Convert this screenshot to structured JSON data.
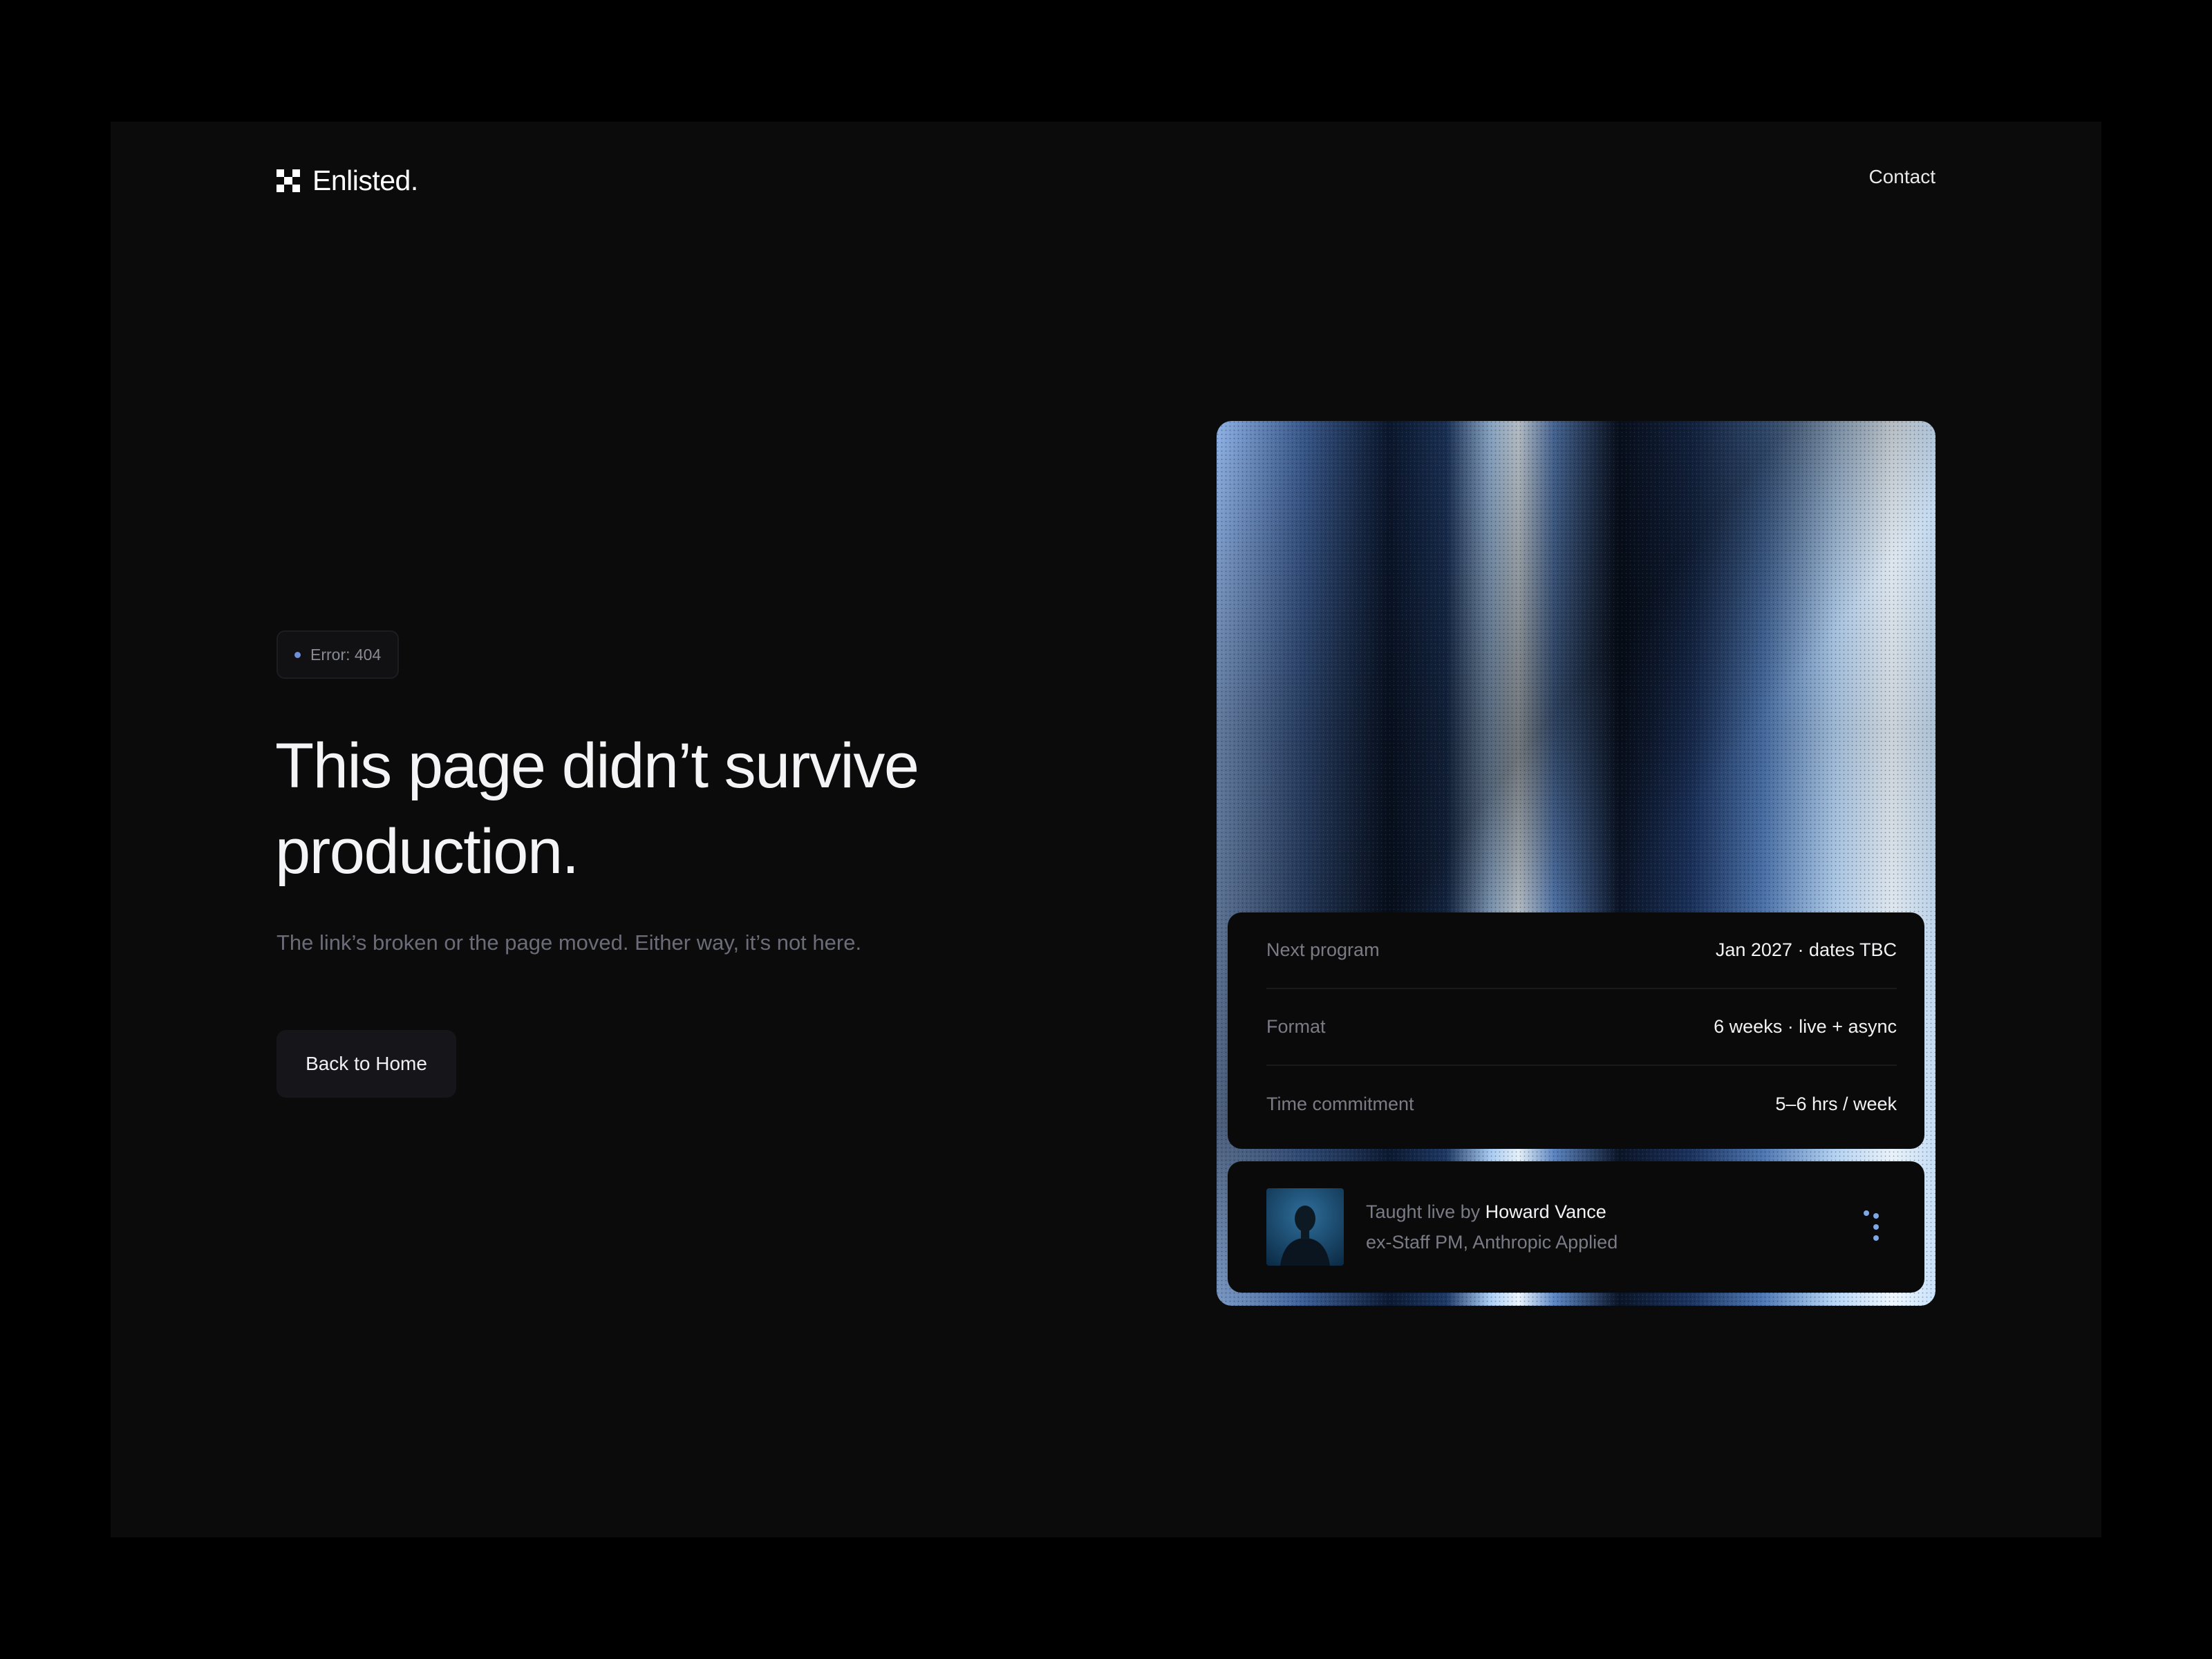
{
  "header": {
    "logo_text": "Enlisted.",
    "contact_label": "Contact"
  },
  "error": {
    "badge": "Error: 404",
    "headline_line1": "This page didn’t survive",
    "headline_line2": "production.",
    "subtext": "The link’s broken or the page moved. Either way, it’s not here.",
    "back_label": "Back to Home"
  },
  "program": {
    "rows": [
      {
        "label": "Next program",
        "value": "Jan 2027 · dates TBC"
      },
      {
        "label": "Format",
        "value": "6 weeks · live + async"
      },
      {
        "label": "Time commitment",
        "value": "5–6 hrs / week"
      }
    ],
    "instructor": {
      "prefix": "Taught live by",
      "name": "Howard Vance",
      "role": "ex-Staff PM, Anthropic Applied"
    }
  },
  "colors": {
    "background": "#0b0b0b",
    "accent": "#7fa7e6",
    "muted_text": "#7b7b86"
  },
  "icons": {
    "logo": "checker-grid-icon",
    "badge_dot": "status-dot-icon",
    "more": "dots-more-icon"
  }
}
